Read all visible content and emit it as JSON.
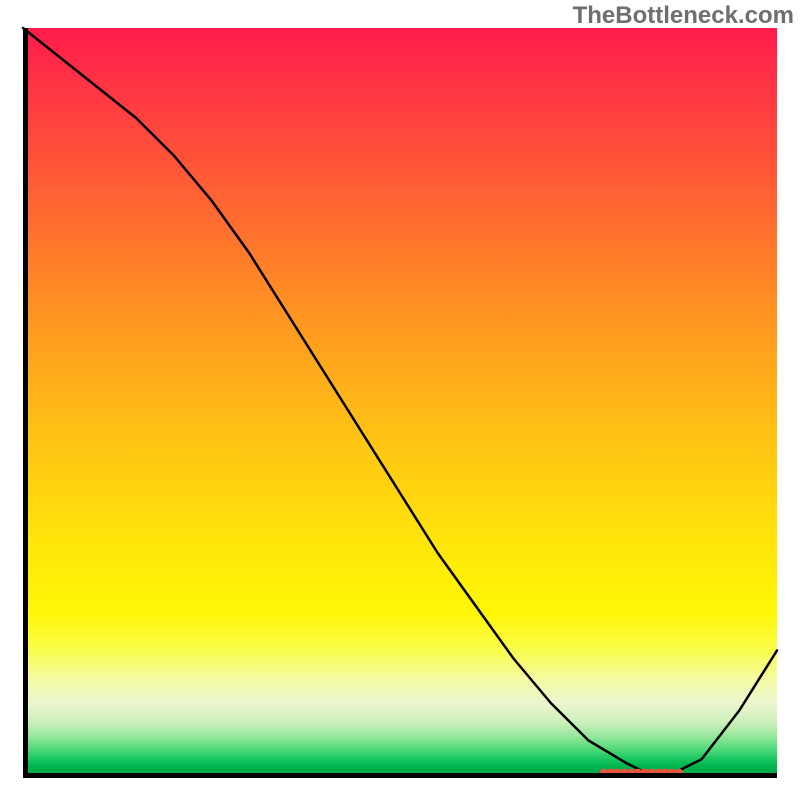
{
  "watermark": "TheBottleneck.com",
  "chart_data": {
    "type": "line",
    "title": "",
    "xlabel": "",
    "ylabel": "",
    "xlim": [
      0,
      100
    ],
    "ylim": [
      0,
      100
    ],
    "grid": false,
    "legend": false,
    "series": [
      {
        "name": "bottleneck-curve",
        "x": [
          0,
          5,
          10,
          15,
          20,
          25,
          30,
          35,
          40,
          45,
          50,
          55,
          60,
          65,
          70,
          75,
          80,
          83,
          86,
          90,
          95,
          100
        ],
        "y": [
          100,
          96,
          92,
          88,
          83,
          77,
          70,
          62,
          54,
          46,
          38,
          30,
          23,
          16,
          10,
          5,
          2,
          0.5,
          0.5,
          2.5,
          9,
          17
        ],
        "color": "#000000",
        "stroke_width": 2.5
      }
    ],
    "annotations": [
      {
        "name": "minimum-band",
        "shape": "dots",
        "x_start": 77,
        "x_end": 87,
        "y": 0.7,
        "color": "#e8543f"
      }
    ],
    "background_gradient": {
      "direction": "vertical",
      "stops": [
        {
          "pos": 0.0,
          "color": "#ff1b4b"
        },
        {
          "pos": 0.3,
          "color": "#ff7a2a"
        },
        {
          "pos": 0.55,
          "color": "#ffc414"
        },
        {
          "pos": 0.78,
          "color": "#fff705"
        },
        {
          "pos": 0.9,
          "color": "#ecf6cf"
        },
        {
          "pos": 0.96,
          "color": "#4fd979"
        },
        {
          "pos": 1.0,
          "color": "#00a344"
        }
      ]
    }
  }
}
